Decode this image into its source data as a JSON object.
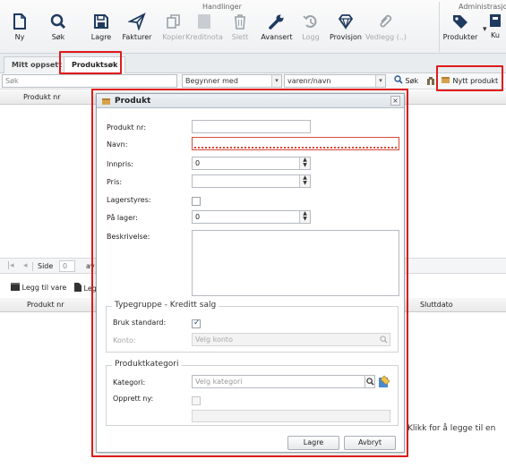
{
  "ribbon": {
    "group_handlinger": "Handlinger",
    "group_administrasjon": "Administrasjo",
    "buttons": [
      {
        "label": "Ny",
        "icon": "new-document-icon",
        "enabled": true
      },
      {
        "label": "Søk",
        "icon": "search-icon",
        "enabled": true
      },
      {
        "label": "Lagre",
        "icon": "save-icon",
        "enabled": true
      },
      {
        "label": "Fakturer",
        "icon": "send-icon",
        "enabled": true
      },
      {
        "label": "Kopier",
        "icon": "copy-icon",
        "enabled": false
      },
      {
        "label": "Kreditnota",
        "icon": "credit-note-icon",
        "enabled": false
      },
      {
        "label": "Slett",
        "icon": "trash-icon",
        "enabled": false
      },
      {
        "label": "Avansert",
        "icon": "wrench-icon",
        "enabled": true
      },
      {
        "label": "Logg",
        "icon": "history-icon",
        "enabled": false
      },
      {
        "label": "Provisjon",
        "icon": "diamond-icon",
        "enabled": true
      },
      {
        "label": "Vedlegg (..)",
        "icon": "paperclip-icon",
        "enabled": false
      },
      {
        "label": "Produkter",
        "icon": "tag-icon",
        "enabled": true
      },
      {
        "label": "Ku",
        "icon": "customer-card-icon",
        "enabled": true
      }
    ]
  },
  "tabs": {
    "mitt_oppsett": "Mitt oppsett",
    "produktsok": "Produktsøk"
  },
  "search": {
    "placeholder": "Søk",
    "match_mode": "Begynner med",
    "field": "varenr/navn",
    "search_button": "Søk",
    "new_product_button": "Nytt produkt"
  },
  "grid": {
    "col_produkt_nr": "Produkt nr"
  },
  "pager": {
    "side_label": "Side",
    "page": "0",
    "of_label": "av"
  },
  "lower_toolbar": {
    "legg_til_vare": "Legg til vare",
    "leg_prefix": "Leg"
  },
  "lower_grid": {
    "col_produkt_nr": "Produkt nr",
    "col_sluttdato": "Sluttdato"
  },
  "empty_hint": "Klikk for å legge til en",
  "dialog": {
    "title": "Produkt",
    "produkt_nr_label": "Produkt nr:",
    "produkt_nr_value": "",
    "navn_label": "Navn:",
    "navn_value": "",
    "innpris_label": "Innpris:",
    "innpris_value": "0",
    "pris_label": "Pris:",
    "pris_value": "",
    "lagerstyres_label": "Lagerstyres:",
    "lagerstyres_checked": false,
    "pa_lager_label": "På lager:",
    "pa_lager_value": "0",
    "beskrivelse_label": "Beskrivelse:",
    "typegruppe_legend": "Typegruppe - Kreditt salg",
    "bruk_standard_label": "Bruk standard:",
    "bruk_standard_checked": true,
    "konto_label": "Konto:",
    "konto_placeholder": "Velg konto",
    "produktkategori_legend": "Produktkategori",
    "kategori_label": "Kategori:",
    "kategori_placeholder": "Velg kategori",
    "opprett_ny_label": "Opprett ny:",
    "lagre_button": "Lagre",
    "avbryt_button": "Avbryt"
  },
  "colors": {
    "highlight": "#e01b1b",
    "accent_blue": "#1f3a5f"
  }
}
